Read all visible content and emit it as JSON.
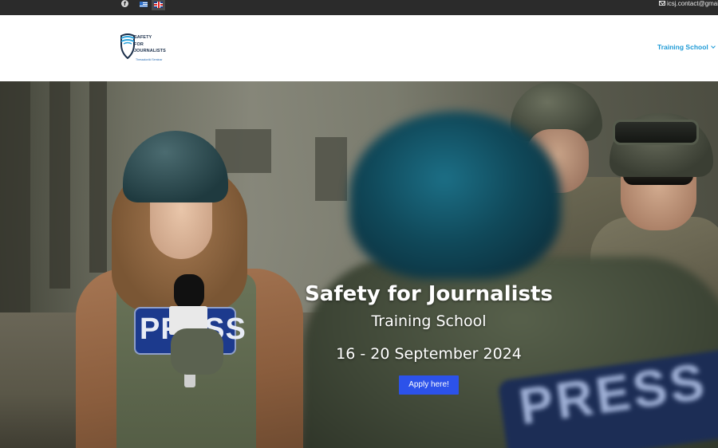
{
  "topbar": {
    "social": [
      {
        "icon": "facebook-icon"
      }
    ],
    "languages": [
      {
        "icon": "greek-flag-icon",
        "code": "el"
      },
      {
        "icon": "uk-flag-icon",
        "code": "en",
        "active": true
      }
    ],
    "contact_email": "icsj.contact@gmail"
  },
  "header": {
    "logo": {
      "line1": "SAFETY",
      "line2": "FOR",
      "line3": "JOURNALISTS",
      "tagline": "Thessaloniki Seminar"
    },
    "nav": {
      "item_label": "Training School"
    }
  },
  "hero": {
    "title": "Safety for Journalists",
    "subtitle": "Training School",
    "dates": "16 - 20 September 2024",
    "cta_label": "Apply here!",
    "photo_press_text": "PRESS"
  },
  "colors": {
    "topbar_bg": "#2b2b2b",
    "nav_link": "#1e9ad6",
    "cta_bg": "#2c52ea"
  }
}
